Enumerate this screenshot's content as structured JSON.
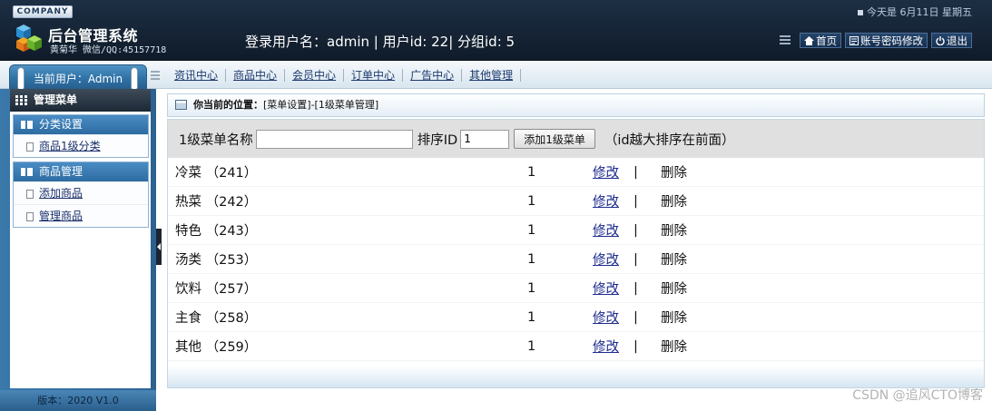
{
  "header": {
    "company_badge": "COMPANY",
    "app_title": "后台管理系统",
    "author_line": "黄菊华 微信/QQ:45157718",
    "login_info": "登录用户名：admin | 用户id: 22| 分组id: 5",
    "date_text": "今天是 6月11日  星期五",
    "actions": {
      "home": "首页",
      "account": "账号密码修改",
      "logout": "退出"
    }
  },
  "navbar": {
    "current_user": "当前用户：Admin",
    "items": [
      "资讯中心",
      "商品中心",
      "会员中心",
      "订单中心",
      "广告中心",
      "其他管理"
    ]
  },
  "sidebar": {
    "menu_title": "管理菜单",
    "groups": [
      {
        "title": "分类设置",
        "items": [
          "商品1级分类"
        ]
      },
      {
        "title": "商品管理",
        "items": [
          "添加商品",
          "管理商品"
        ]
      }
    ],
    "version": "版本：2020 V1.0"
  },
  "breadcrumb": {
    "label": "你当前的位置：",
    "path": "[菜单设置]-[1级菜单管理]"
  },
  "form": {
    "name_label": "1级菜单名称",
    "name_value": "",
    "sort_label": "排序ID",
    "sort_value": "1",
    "add_button": "添加1级菜单",
    "hint": "（id越大排序在前面）"
  },
  "rows": [
    {
      "name": "冷菜 （241）",
      "sort": "1",
      "edit": "修改",
      "sep": "|",
      "del": "删除"
    },
    {
      "name": "热菜 （242）",
      "sort": "1",
      "edit": "修改",
      "sep": "|",
      "del": "删除"
    },
    {
      "name": "特色 （243）",
      "sort": "1",
      "edit": "修改",
      "sep": "|",
      "del": "删除"
    },
    {
      "name": "汤类 （253）",
      "sort": "1",
      "edit": "修改",
      "sep": "|",
      "del": "删除"
    },
    {
      "name": "饮料 （257）",
      "sort": "1",
      "edit": "修改",
      "sep": "|",
      "del": "删除"
    },
    {
      "name": "主食 （258）",
      "sort": "1",
      "edit": "修改",
      "sep": "|",
      "del": "删除"
    },
    {
      "name": "其他 （259）",
      "sort": "1",
      "edit": "修改",
      "sep": "|",
      "del": "删除"
    }
  ],
  "watermark": "CSDN @追风CTO博客",
  "colors": {
    "header_bg": "#172638",
    "sidebar_blue": "#2f6e9f",
    "link": "#1d2b8c"
  }
}
